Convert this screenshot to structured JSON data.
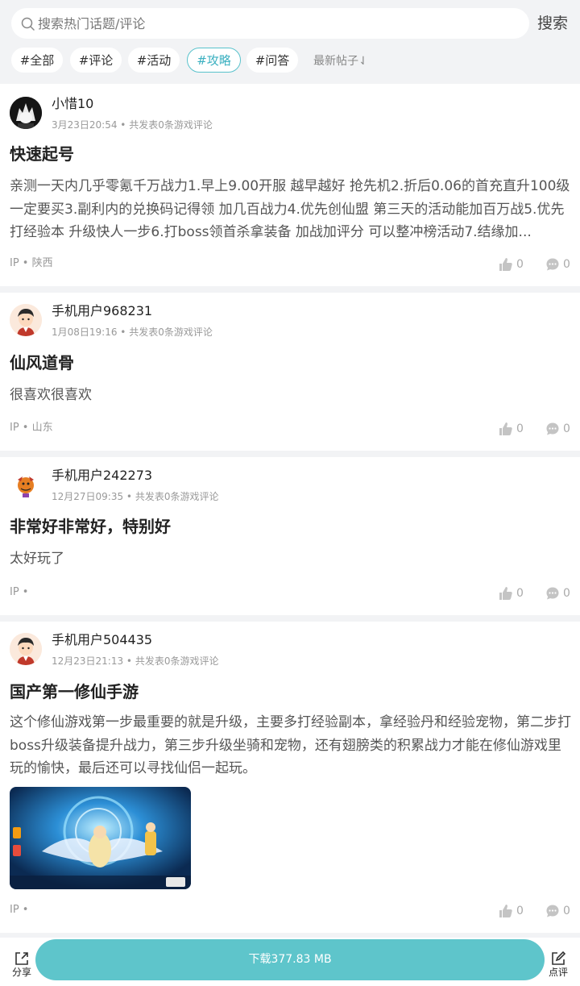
{
  "search": {
    "placeholder": "搜索热门话题/评论",
    "button": "搜索"
  },
  "tabs": [
    {
      "label": "#全部"
    },
    {
      "label": "#评论"
    },
    {
      "label": "#活动"
    },
    {
      "label": "#攻略",
      "active": true
    },
    {
      "label": "#问答"
    }
  ],
  "sort_label": "最新帖子⇃",
  "posts": [
    {
      "user": "小惜10",
      "meta": "3月23日20:54 • 共发表0条游戏评论",
      "title": "快速起号",
      "body": "亲测一天内几乎零氪千万战力1.早上9.00开服 越早越好 抢先机2.折后0.06的首充直升100级 一定要买3.副利内的兑换码记得领 加几百战力4.优先创仙盟 第三天的活动能加百万战5.优先打经验本 升级快人一步6.打boss领首杀拿装备 加战加评分 可以整冲榜活动7.结缘加...",
      "ip": "IP • 陕西",
      "likes": "0",
      "comments": "0"
    },
    {
      "user": "手机用户968231",
      "meta": "1月08日19:16 • 共发表0条游戏评论",
      "title": "仙风道骨",
      "body": "很喜欢很喜欢",
      "ip": "IP • 山东",
      "likes": "0",
      "comments": "0"
    },
    {
      "user": "手机用户242273",
      "meta": "12月27日09:35 • 共发表0条游戏评论",
      "title": "非常好非常好，特别好",
      "body": "太好玩了",
      "ip": "IP •",
      "likes": "0",
      "comments": "0"
    },
    {
      "user": "手机用户504435",
      "meta": "12月23日21:13 • 共发表0条游戏评论",
      "title": "国产第一修仙手游",
      "body": "这个修仙游戏第一步最重要的就是升级，主要多打经验副本，拿经验丹和经验宠物，第二步打boss升级装备提升战力，第三步升级坐骑和宠物，还有翅膀类的积累战力才能在修仙游戏里玩的愉快，最后还可以寻找仙侣一起玩。",
      "ip": "IP •",
      "likes": "0",
      "comments": "0"
    }
  ],
  "bottom": {
    "share": "分享",
    "download": "下载377.83 MB",
    "review": "点评"
  },
  "colors": {
    "accent": "#5ec5cb",
    "tab_active": "#3bb0c0",
    "background": "#f2f3f5"
  }
}
